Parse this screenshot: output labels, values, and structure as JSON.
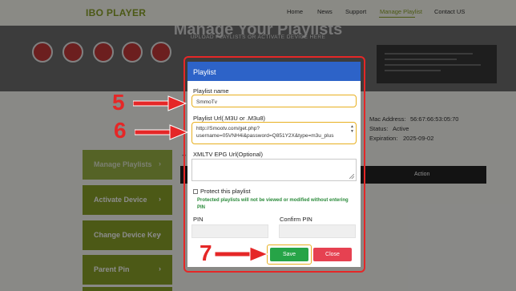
{
  "app": {
    "logo": "IBO PLAYER"
  },
  "nav": {
    "items": [
      {
        "label": "Home"
      },
      {
        "label": "News"
      },
      {
        "label": "Support"
      },
      {
        "label": "Manage Playlist"
      },
      {
        "label": "Contact US"
      }
    ],
    "active_index": 3
  },
  "hero": {
    "title": "Manage Your Playlists",
    "subtitle": "UPLOAD PLAYLISTS OR ACTIVATE DEVICE HERE"
  },
  "menu": {
    "items": [
      {
        "label": "Manage Playlists",
        "arrow": "›"
      },
      {
        "label": "Activate Device",
        "arrow": "›"
      },
      {
        "label": "Change Device Key",
        "arrow": "›"
      },
      {
        "label": "Parent Pin",
        "arrow": "›"
      }
    ]
  },
  "device": {
    "mac_label": "Mac Address:",
    "mac_value": "56:67:66:53:05:70",
    "status_label": "Status:",
    "status_value": "Active",
    "expiration_label": "Expiration:",
    "expiration_value": "2025-09-02"
  },
  "table": {
    "add_symbol": "+",
    "action_header": "Action"
  },
  "dialog": {
    "title": "Playlist",
    "name_label": "Playlist name",
    "name_value": "SmmoTv",
    "url_label": "Playlist Url(.M3U or .M3u8)",
    "url_line1": "http://Smootv.com/get.php?",
    "url_line2": "username=05VNH4i&password=Q851Y2X&type=m3u_plus",
    "epg_label": "XMLTV EPG Url(Optional)",
    "epg_value": "",
    "protect_label": "Protect this playlist",
    "protect_checked": false,
    "protect_note": "Protected playlists will not be viewed or modified without entering PIN",
    "pin_label": "PIN",
    "confirm_pin_label": "Confirm PIN",
    "save_label": "Save",
    "close_label": "Close"
  },
  "annotations": [
    {
      "number": "5"
    },
    {
      "number": "6"
    },
    {
      "number": "7"
    }
  ],
  "colors": {
    "brand_green": "#8aa228",
    "dialog_header": "#2d63c8",
    "annotation_red": "#e52727",
    "highlight_yellow": "#e8b020",
    "save_green": "#26a447",
    "close_red": "#e64151",
    "note_green": "#2a8a3a"
  },
  "icons": {
    "arrow": "right-arrow-icon",
    "scroll": "scroll-arrows-icon",
    "resize": "resize-grip-icon"
  }
}
